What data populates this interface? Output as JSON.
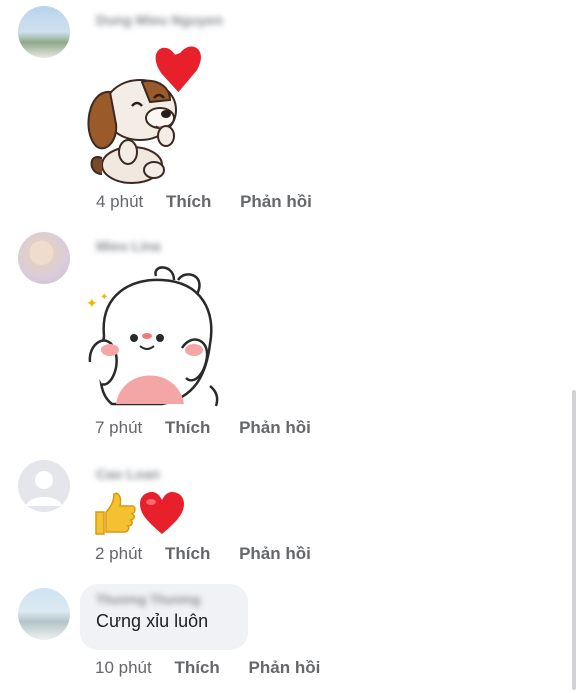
{
  "comments": [
    {
      "author": "Dung Mieu Nguyen",
      "time": "4 phút",
      "like": "Thích",
      "reply": "Phản hồi",
      "content_type": "sticker",
      "sticker_icon": "dog-heart-sticker-icon"
    },
    {
      "author": "Mieu Lina",
      "time": "7 phút",
      "like": "Thích",
      "reply": "Phản hồi",
      "content_type": "sticker",
      "sticker_icon": "bunny-sticker-icon"
    },
    {
      "author": "Cao Loan",
      "time": "2 phút",
      "like": "Thích",
      "reply": "Phản hồi",
      "content_type": "emoji",
      "emoji_icons": [
        "thumbs-up-icon",
        "red-heart-icon"
      ]
    },
    {
      "author": "Thương Thương",
      "text": "Cưng xỉu luôn",
      "time": "10 phút",
      "like": "Thích",
      "reply": "Phản hồi",
      "content_type": "text"
    }
  ],
  "colors": {
    "meta": "#65676b",
    "bubble": "#f0f2f5",
    "heart": "#e8202b",
    "thumb": "#f5c133"
  }
}
